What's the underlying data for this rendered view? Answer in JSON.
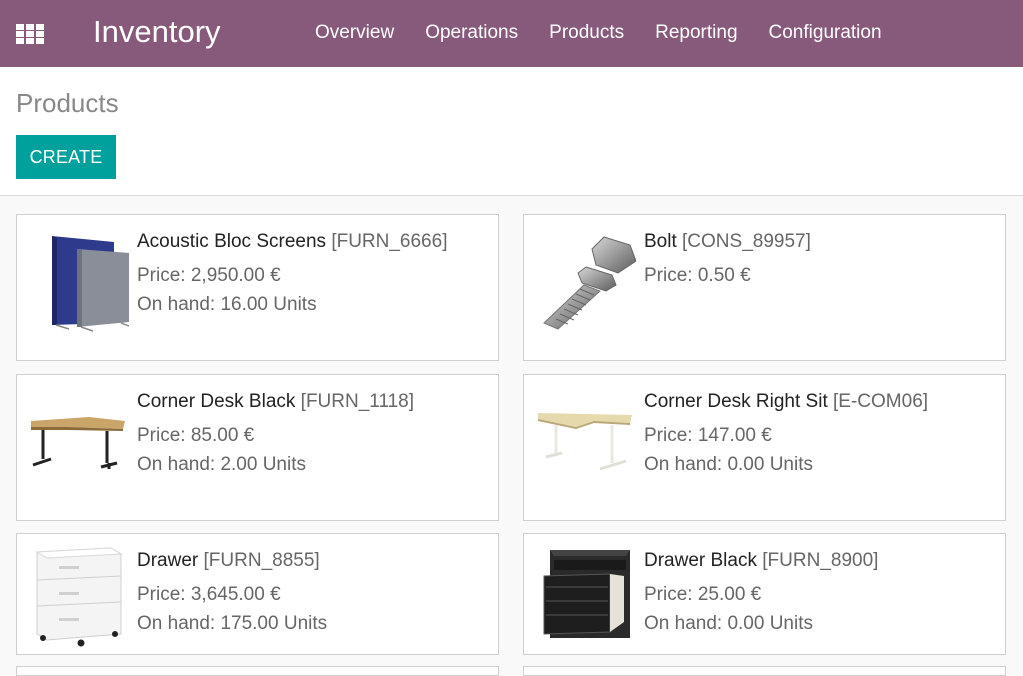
{
  "navbar": {
    "brand": "Inventory",
    "menu": [
      "Overview",
      "Operations",
      "Products",
      "Reporting",
      "Configuration"
    ],
    "background": "#875a7b"
  },
  "control_panel": {
    "title": "Products",
    "create_label": "CREATE",
    "create_color": "#00a09d"
  },
  "products": [
    {
      "name": "Acoustic Bloc Screens",
      "ref": "[FURN_6666]",
      "price": "Price: 2,950.00 €",
      "onhand": "On hand: 16.00 Units",
      "icon": "acoustic-screens-image"
    },
    {
      "name": "Bolt",
      "ref": "[CONS_89957]",
      "price": "Price: 0.50 €",
      "onhand": "",
      "icon": "bolt-image"
    },
    {
      "name": "Corner Desk Black",
      "ref": "[FURN_1118]",
      "price": "Price: 85.00 €",
      "onhand": "On hand: 2.00 Units",
      "icon": "corner-desk-black-image"
    },
    {
      "name": "Corner Desk Right Sit",
      "ref": "[E-COM06]",
      "price": "Price: 147.00 €",
      "onhand": "On hand: 0.00 Units",
      "icon": "corner-desk-right-image"
    },
    {
      "name": "Drawer",
      "ref": "[FURN_8855]",
      "price": "Price: 3,645.00 €",
      "onhand": "On hand: 175.00 Units",
      "icon": "drawer-image"
    },
    {
      "name": "Drawer Black",
      "ref": "[FURN_8900]",
      "price": "Price: 25.00 €",
      "onhand": "On hand: 0.00 Units",
      "icon": "drawer-black-image"
    }
  ]
}
